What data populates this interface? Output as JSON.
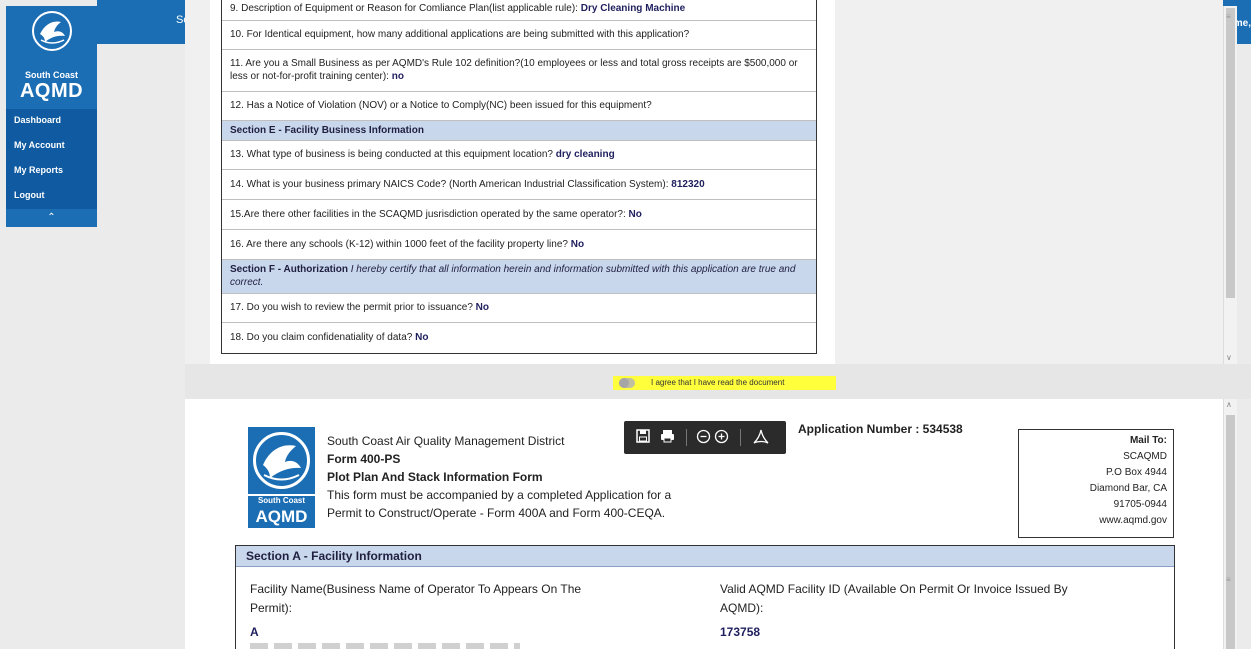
{
  "header": {
    "left_fragment": "Sc",
    "right_fragment": "me,"
  },
  "sidebar": {
    "brand_small": "South Coast",
    "brand_big": "AQMD",
    "items": [
      {
        "label": "Dashboard"
      },
      {
        "label": "My Account"
      },
      {
        "label": "My Reports"
      },
      {
        "label": "Logout"
      }
    ],
    "collapse_icon": "chevron-up-icon"
  },
  "questions": {
    "q9": {
      "text": "9. Description of Equipment or Reason for Comliance Plan(list applicable rule): ",
      "answer": "Dry Cleaning Machine"
    },
    "q10": {
      "text": "10. For Identical equipment, how many additional applications are being submitted with this application?"
    },
    "q11": {
      "text": "11. Are you a Small Business as per AQMD's Rule 102 definition?(10 employees or less and total gross receipts are $500,000 or less or not-for-profit training center): ",
      "answer": "no"
    },
    "q12": {
      "text": "12. Has a Notice of Violation (NOV) or a Notice to Comply(NC) been issued for this equipment?"
    },
    "sectionE": "Section E - Facility Business Information",
    "q13": {
      "text": "13. What type of business is being conducted at this equipment location? ",
      "answer": "dry cleaning"
    },
    "q14": {
      "text": "14. What is your business primary NAICS Code? (North American Industrial Classification System): ",
      "answer": "812320"
    },
    "q15": {
      "text": "15.Are there other facilities in the SCAQMD jusrisdiction operated by the same operator?: ",
      "answer": "No"
    },
    "q16": {
      "text": "16. Are there any schools (K-12) within 1000 feet of the facility property line? ",
      "answer": "No"
    },
    "sectionF": {
      "title": "Section F - Authorization",
      "note": " I hereby certify that all information herein and information submitted with this application are true and correct."
    },
    "q17": {
      "text": "17. Do you wish to review the permit prior to issuance? ",
      "answer": "No"
    },
    "q18": {
      "text": "18. Do you claim confidenatiality of data? ",
      "answer": "No"
    }
  },
  "agree": {
    "label": "I agree that I have read the document",
    "checked": false,
    "highlight": "#ffff3c"
  },
  "form": {
    "logo_small": "South Coast",
    "logo_big": "AQMD",
    "district": "South Coast Air Quality Management District",
    "form_no": "Form 400-PS",
    "form_title": "Plot Plan And Stack Information Form",
    "note_line1": "This form must be accompanied by a completed Application for a",
    "note_line2": "Permit to Construct/Operate - Form 400A and Form 400-CEQA.",
    "app_number": "Application Number : 534538",
    "toolbar": {
      "icons": [
        "save-icon",
        "print-icon",
        "zoom-out-icon",
        "zoom-in-icon",
        "pdf-icon"
      ]
    },
    "mail": {
      "title": "Mail To:",
      "lines": [
        "SCAQMD",
        "P.O Box 4944",
        "Diamond Bar, CA",
        "91705-0944",
        "www.aqmd.gov"
      ]
    },
    "sectionA": {
      "title": "Section A - Facility Information",
      "facility_name_label_1": "Facility Name(Business Name of Operator To Appears On The",
      "facility_name_label_2": "Permit):",
      "facility_name_value": "A",
      "facility_id_label_1": "Valid AQMD Facility ID (Available On Permit Or Invoice Issued By",
      "facility_id_label_2": "AQMD):",
      "facility_id_value": "173758"
    }
  },
  "colors": {
    "brand_blue": "#1c6eb4",
    "section_bg": "#c9d7ed",
    "answer_text": "#1f1f5e"
  }
}
